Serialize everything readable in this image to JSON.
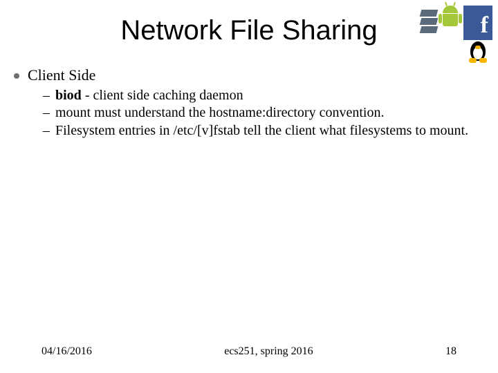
{
  "title": "Network File Sharing",
  "section": "Client Side",
  "bullets": [
    {
      "bold": "biod",
      "rest": " - client side caching daemon"
    },
    {
      "bold": "",
      "rest": "mount must understand the hostname:directory convention."
    },
    {
      "bold": "",
      "rest": "Filesystem entries in /etc/[v]fstab tell the client what filesystems to mount."
    }
  ],
  "footer": {
    "date": "04/16/2016",
    "course": "ecs251, spring 2016",
    "page": "18"
  }
}
